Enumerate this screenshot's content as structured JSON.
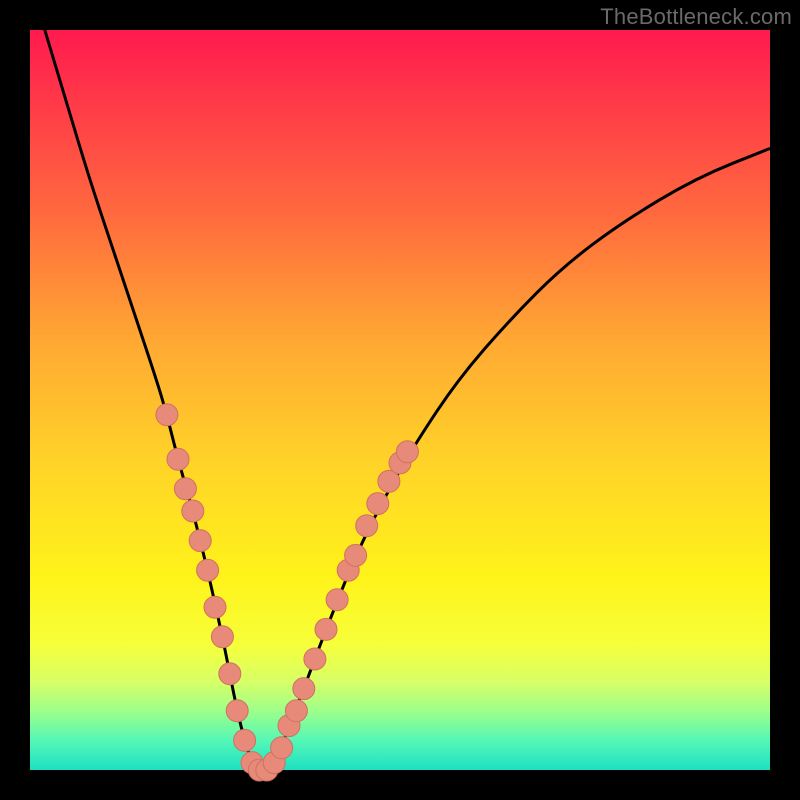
{
  "watermark": "TheBottleneck.com",
  "colors": {
    "curve": "#000000",
    "marker_fill": "#e78a7a",
    "marker_stroke": "#d07060"
  },
  "chart_data": {
    "type": "line",
    "title": "",
    "xlabel": "",
    "ylabel": "",
    "xlim": [
      0,
      100
    ],
    "ylim": [
      0,
      100
    ],
    "grid": false,
    "series": [
      {
        "name": "bottleneck-curve",
        "x": [
          2,
          5,
          8,
          11,
          14,
          17,
          18.5,
          20,
          22,
          24,
          26,
          27,
          28,
          29,
          30,
          31,
          32,
          33,
          34,
          35,
          37,
          40,
          44,
          48,
          52,
          58,
          65,
          72,
          80,
          90,
          100
        ],
        "y": [
          100,
          90,
          80,
          71,
          62,
          53,
          48,
          42,
          35,
          27,
          18,
          13,
          8,
          4,
          1,
          0,
          0,
          1,
          3,
          6,
          11,
          19,
          29,
          37,
          44,
          53,
          61,
          68,
          74,
          80,
          84
        ]
      }
    ],
    "markers": [
      {
        "x": 18.5,
        "y": 48
      },
      {
        "x": 20,
        "y": 42
      },
      {
        "x": 21,
        "y": 38
      },
      {
        "x": 22,
        "y": 35
      },
      {
        "x": 23,
        "y": 31
      },
      {
        "x": 24,
        "y": 27
      },
      {
        "x": 25,
        "y": 22
      },
      {
        "x": 26,
        "y": 18
      },
      {
        "x": 27,
        "y": 13
      },
      {
        "x": 28,
        "y": 8
      },
      {
        "x": 29,
        "y": 4
      },
      {
        "x": 30,
        "y": 1
      },
      {
        "x": 31,
        "y": 0
      },
      {
        "x": 32,
        "y": 0
      },
      {
        "x": 33,
        "y": 1
      },
      {
        "x": 34,
        "y": 3
      },
      {
        "x": 35,
        "y": 6
      },
      {
        "x": 36,
        "y": 8
      },
      {
        "x": 37,
        "y": 11
      },
      {
        "x": 38.5,
        "y": 15
      },
      {
        "x": 40,
        "y": 19
      },
      {
        "x": 41.5,
        "y": 23
      },
      {
        "x": 43,
        "y": 27
      },
      {
        "x": 44,
        "y": 29
      },
      {
        "x": 45.5,
        "y": 33
      },
      {
        "x": 47,
        "y": 36
      },
      {
        "x": 48.5,
        "y": 39
      },
      {
        "x": 50,
        "y": 41.5
      },
      {
        "x": 51,
        "y": 43
      }
    ]
  }
}
